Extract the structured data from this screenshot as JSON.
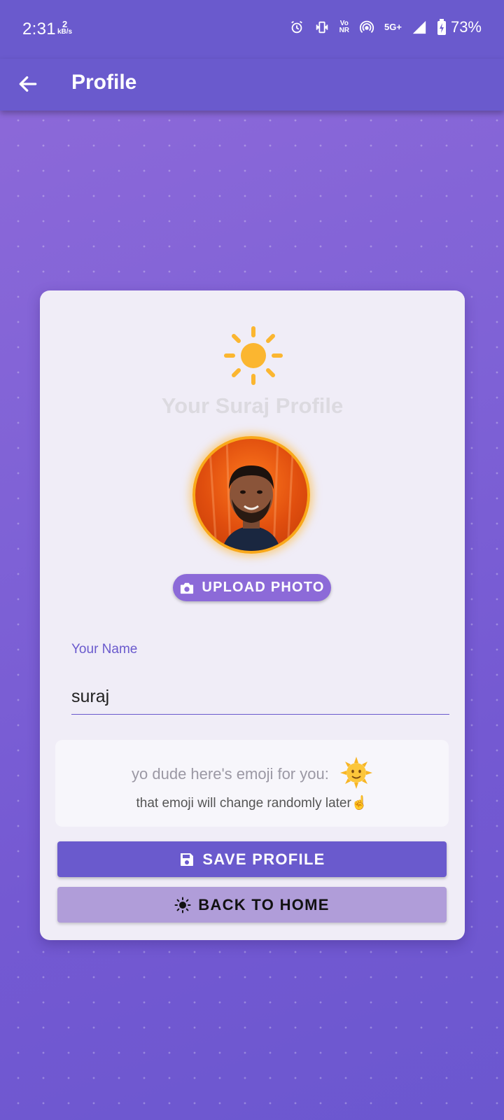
{
  "status_bar": {
    "time": "2:31",
    "net_speed_value": "2",
    "net_speed_unit": "kB/s",
    "volte_label_top": "Vo",
    "volte_label_bottom": "NR",
    "network_label": "5G+",
    "battery_percent": "73%"
  },
  "app_bar": {
    "title": "Profile",
    "back_icon": "arrow-back-icon"
  },
  "card": {
    "header_icon": "sun-icon",
    "title": "Your Suraj Profile",
    "upload_button_label": "UPLOAD PHOTO",
    "upload_icon": "camera-icon",
    "name_field": {
      "label": "Your Name",
      "value": "suraj"
    },
    "emoji_box": {
      "line1": "yo dude here's emoji for you:",
      "emoji": "🌞",
      "line2": "that emoji will change randomly later☝️"
    },
    "save_button_label": "SAVE PROFILE",
    "save_icon": "save-icon",
    "home_button_label": "BACK TO HOME",
    "home_icon": "brightness-icon"
  },
  "colors": {
    "primary": "#6a5acd",
    "accent_sun": "#fbb630",
    "secondary_button": "#b09dd9"
  }
}
